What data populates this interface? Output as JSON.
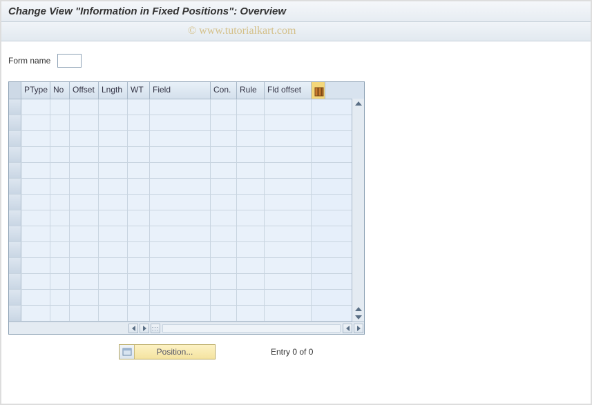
{
  "header": {
    "title": "Change View \"Information in Fixed Positions\": Overview"
  },
  "watermark": "© www.tutorialkart.com",
  "form": {
    "label": "Form name",
    "value": ""
  },
  "table": {
    "columns": {
      "ptype": "PType",
      "no": "No",
      "offset": "Offset",
      "lngth": "Lngth",
      "wt": "WT",
      "field": "Field",
      "con": "Con.",
      "rule": "Rule",
      "fldoffset": "Fld offset"
    },
    "rows_visible": 14
  },
  "footer": {
    "position_label": "Position...",
    "entry_text": "Entry 0 of 0"
  }
}
